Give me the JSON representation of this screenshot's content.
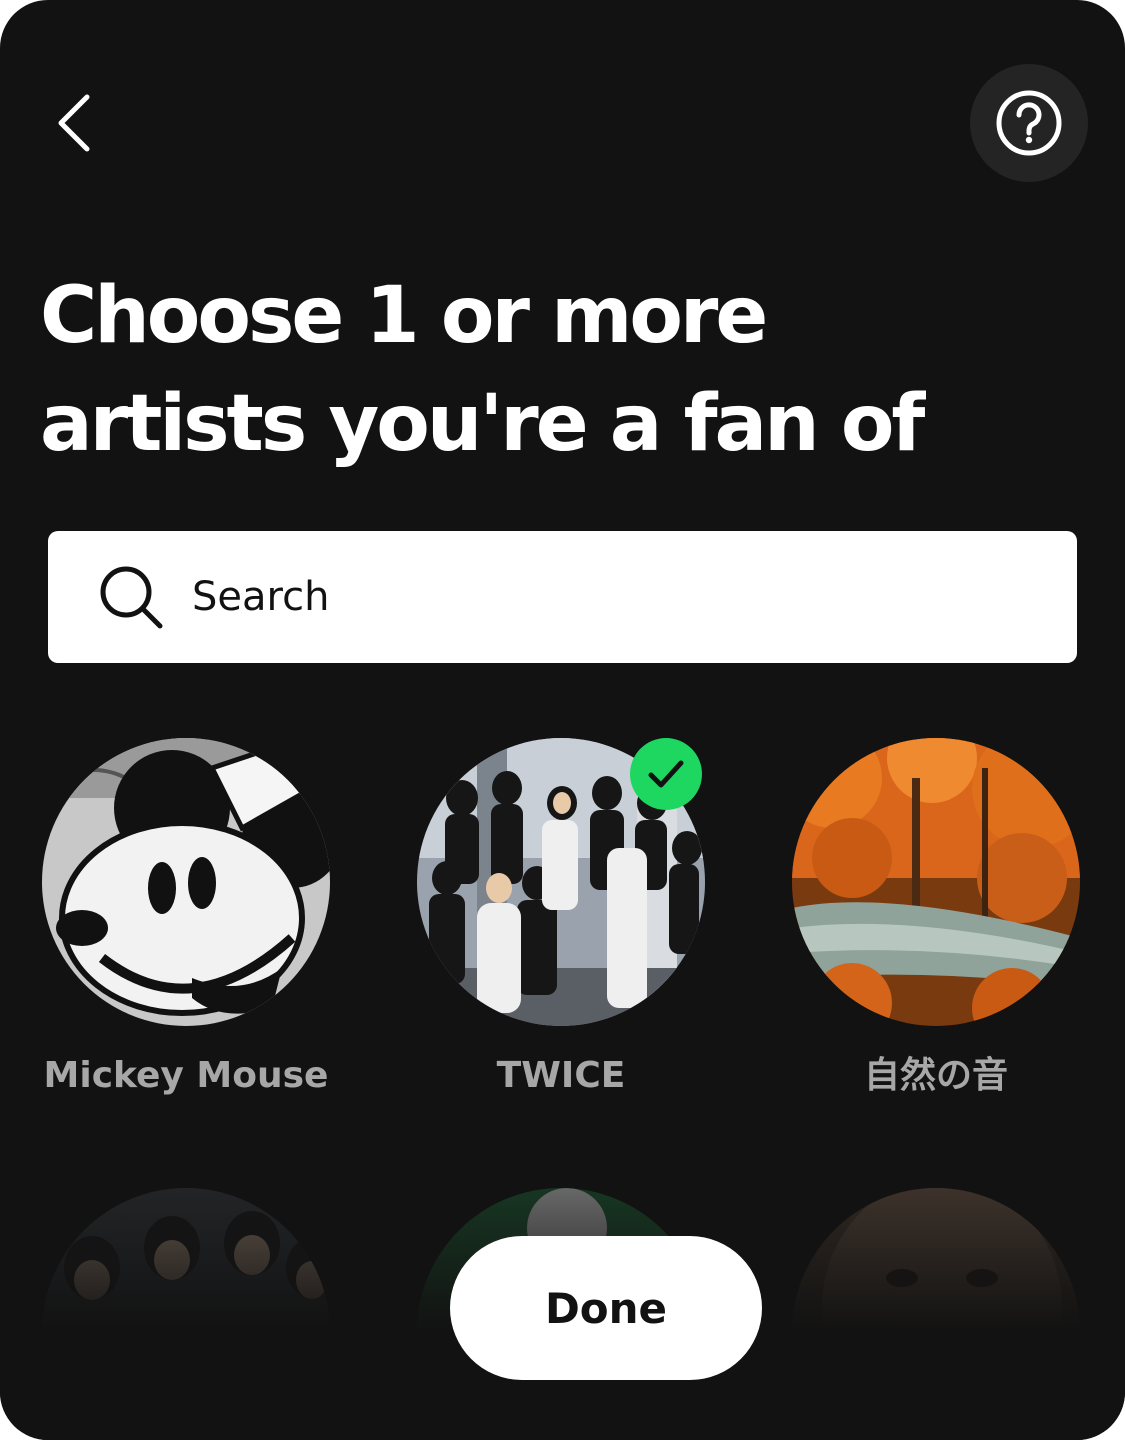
{
  "header": {
    "back_icon": "chevron-left-icon",
    "help_icon": "question-circle-icon"
  },
  "title": {
    "line1": "Choose 1 or more",
    "line2": "artists you're a fan of"
  },
  "search": {
    "icon": "search-icon",
    "placeholder": "Search"
  },
  "artists": [
    {
      "name": "Mickey Mouse",
      "selected": false
    },
    {
      "name": "TWICE",
      "selected": true
    },
    {
      "name": "自然の音",
      "selected": false
    },
    {
      "name": "",
      "selected": false
    },
    {
      "name": "",
      "selected": false
    },
    {
      "name": "",
      "selected": false
    }
  ],
  "colors": {
    "background": "#121212",
    "accent_green": "#1ed760",
    "label_grey": "#a7a7a7",
    "white": "#ffffff"
  },
  "done_button": {
    "label": "Done"
  }
}
